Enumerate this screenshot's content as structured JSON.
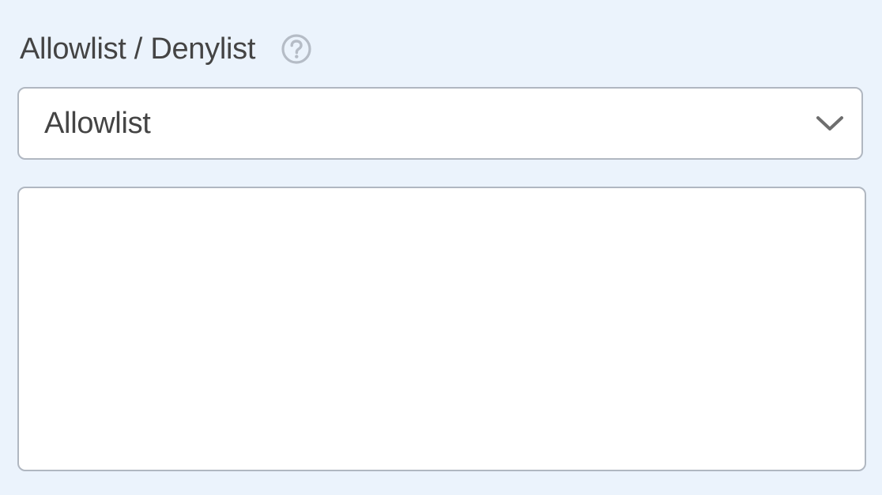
{
  "field": {
    "label": "Allowlist / Denylist",
    "help_icon": "question-circle-icon"
  },
  "select": {
    "selected_value": "Allowlist",
    "options": [
      "Allowlist"
    ],
    "dropdown_icon": "chevron-down-icon"
  },
  "textarea": {
    "value": "",
    "placeholder": ""
  },
  "colors": {
    "background": "#ebf3fc",
    "text": "#444444",
    "border": "#b0b7c1",
    "icon": "#b5bcc6",
    "chevron": "#6e6e6e",
    "input_bg": "#ffffff"
  }
}
